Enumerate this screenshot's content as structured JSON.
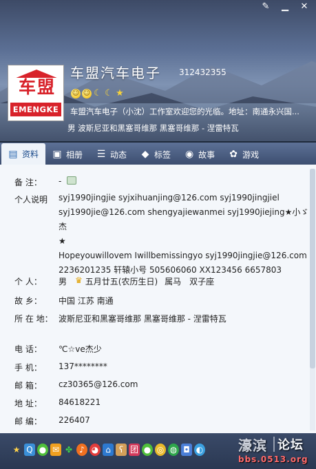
{
  "window": {
    "controls": [
      "edit-icon",
      "minimize-icon",
      "close-icon"
    ]
  },
  "profile": {
    "nickname": "车盟汽车电子",
    "qq_number": "312432355",
    "avatar_text_cn": "车盟",
    "avatar_text_en": "EMENGKE",
    "signature": "车盟汽车电子（小沈）工作室欢迎您的光临。地址：南通永兴国...",
    "summary": "男  波斯尼亚和黑塞哥维那 黑塞哥维那 - 涅雷特瓦"
  },
  "tabs": [
    {
      "label": "资料",
      "icon": "profile-card-icon",
      "active": true
    },
    {
      "label": "相册",
      "icon": "photo-album-icon",
      "active": false
    },
    {
      "label": "动态",
      "icon": "feed-icon",
      "active": false
    },
    {
      "label": "标签",
      "icon": "tag-icon",
      "active": false
    },
    {
      "label": "故事",
      "icon": "story-icon",
      "active": false
    },
    {
      "label": "游戏",
      "icon": "game-icon",
      "active": false
    }
  ],
  "details": {
    "remark": {
      "label": "备    注：",
      "value": "-"
    },
    "bio": {
      "label": "个人说明",
      "lines": [
        "syj1990jingjie    syjxihuanjing@126.com      syj1990jingjiel",
        "syj1990jie@126.com shengyajiewanmei syj1990jiejing★小ゞ杰",
        "★",
        "Hopeyouwillovem   Iwillbemissingyo syj1990jingjie@126.com",
        "2236201235 轩辕小号    505606060   XX123456   6657803"
      ]
    },
    "personal": {
      "label": "个    人：",
      "gender": "男",
      "birthday": "五月廿五(农历生日)",
      "zodiac": "属马",
      "constellation": "双子座"
    },
    "hometown": {
      "label": "故    乡：",
      "value": "中国 江苏 南通"
    },
    "location": {
      "label": "所 在 地：",
      "value": "波斯尼亚和黑塞哥维那 黑塞哥维那 - 涅雷特瓦"
    },
    "phone": {
      "label": "电    话：",
      "value": "℃☆ve杰少"
    },
    "mobile": {
      "label": "手    机：",
      "value": "137********"
    },
    "email": {
      "label": "邮    箱：",
      "value": "cz30365@126.com"
    },
    "address": {
      "label": "地    址：",
      "value": "84618221"
    },
    "postcode": {
      "label": "邮    编：",
      "value": "226407"
    }
  },
  "watermark": {
    "name": "濠滨",
    "forum": "论坛",
    "url": "bbs.0513.org"
  },
  "colors": {
    "tab_bar": "#46577a",
    "content_bg": "#f4f7fb",
    "brand_red": "#d8222a"
  }
}
